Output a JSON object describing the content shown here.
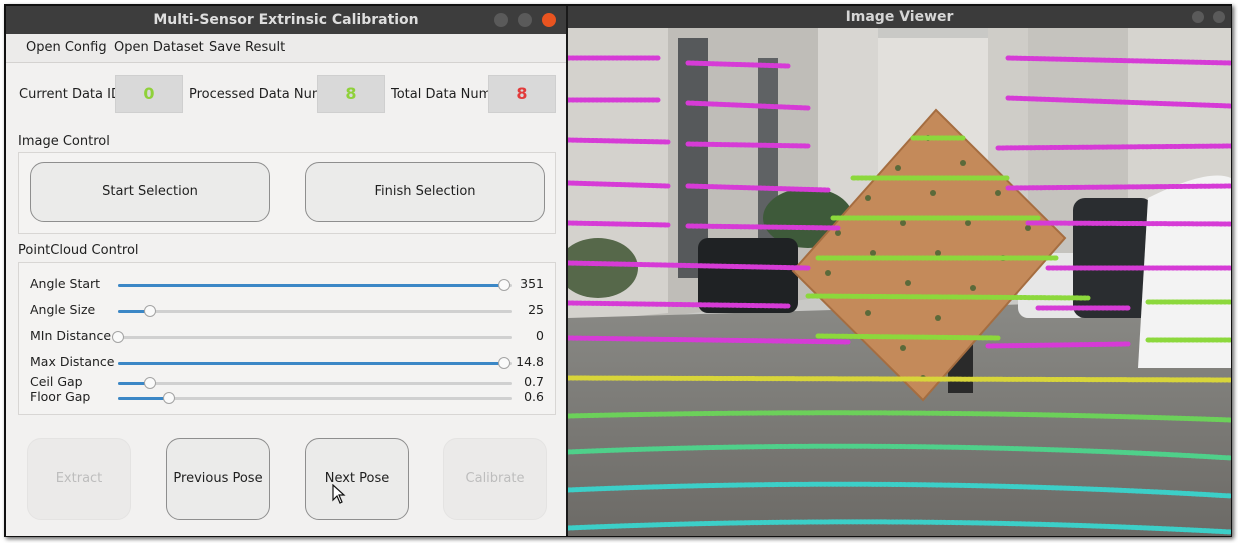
{
  "main_window": {
    "title": "Multi-Sensor Extrinsic Calibration",
    "menu": [
      "Open Config",
      "Open Dataset",
      "Save Result"
    ],
    "status": {
      "current_data_id_label": "Current Data ID",
      "current_data_id": "0",
      "processed_label": "Processed Data Num",
      "processed": "8",
      "total_label": "Total Data Num",
      "total": "8"
    },
    "image_control": {
      "label": "Image Control",
      "start_label": "Start Selection",
      "finish_label": "Finish Selection"
    },
    "pointcloud_control": {
      "label": "PointCloud Control",
      "sliders": [
        {
          "label": "Angle Start",
          "value": "351",
          "fraction": 0.98
        },
        {
          "label": "Angle Size",
          "value": "25",
          "fraction": 0.08
        },
        {
          "label": "MIn Distance",
          "value": "0",
          "fraction": 0.0
        },
        {
          "label": "Max Distance",
          "value": "14.8",
          "fraction": 0.98
        },
        {
          "label": "Ceil Gap",
          "value": "0.7",
          "fraction": 0.08
        },
        {
          "label": "Floor Gap",
          "value": "0.6",
          "fraction": 0.13
        }
      ]
    },
    "actions": {
      "extract": "Extract",
      "previous": "Previous Pose",
      "next": "Next Pose",
      "calibrate": "Calibrate"
    }
  },
  "image_viewer": {
    "title": "Image Viewer"
  },
  "colors": {
    "current_id": "#8fd13a",
    "processed": "#8fd13a",
    "total": "#e23b3b",
    "slider_fill": "#3b87c6",
    "close_button": "#e95420",
    "lidar_magenta": "#d63bd6",
    "lidar_green": "#8cd83c",
    "lidar_yellow": "#d8d53a",
    "lidar_cyan": "#3ccfc8"
  }
}
